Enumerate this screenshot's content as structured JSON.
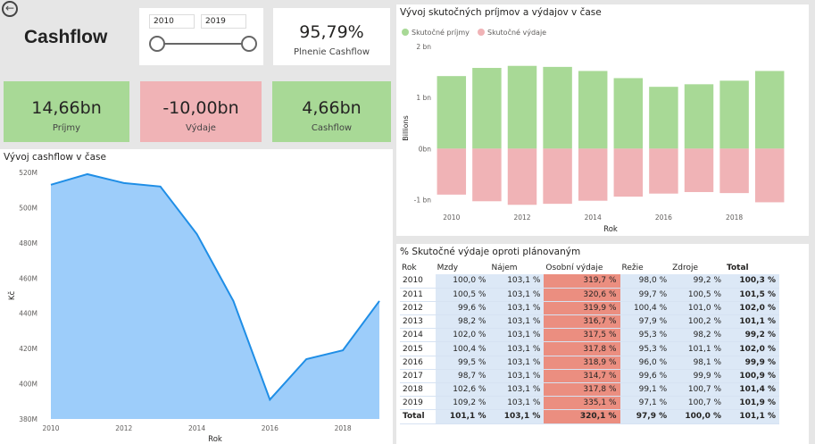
{
  "header": {
    "title": "Cashflow"
  },
  "slicer": {
    "from": "2010",
    "to": "2019"
  },
  "plnenie": {
    "value": "95,79%",
    "label": "Plnenie Cashflow"
  },
  "kpis": [
    {
      "value": "14,66bn",
      "label": "Príjmy"
    },
    {
      "value": "-10,00bn",
      "label": "Výdaje"
    },
    {
      "value": "4,66bn",
      "label": "Cashflow"
    }
  ],
  "colors": {
    "income": "#a8d996",
    "expense": "#f0b3b6",
    "area": "#9dcdfa",
    "line": "#1f8ee6",
    "hot": "#eb8e80",
    "cell": "#dce8f6"
  },
  "chart_data": [
    {
      "type": "area",
      "title": "Vývoj cashflow v čase",
      "xlabel": "Rok",
      "ylabel": "Kč",
      "x": [
        2010,
        2011,
        2012,
        2013,
        2014,
        2015,
        2016,
        2017,
        2018,
        2019
      ],
      "values": [
        513,
        519,
        514,
        512,
        485,
        447,
        391,
        414,
        419,
        447
      ],
      "yunit": "M",
      "ylim": [
        380,
        520
      ],
      "yticks": [
        "380M",
        "400M",
        "420M",
        "440M",
        "460M",
        "480M",
        "500M",
        "520M"
      ],
      "ytick_values": [
        380,
        400,
        420,
        440,
        460,
        480,
        500,
        520
      ],
      "xticks": [
        "2010",
        "2012",
        "2014",
        "2016",
        "2018"
      ]
    },
    {
      "type": "bar",
      "title": "Vývoj skutočných príjmov a výdajov v čase",
      "xlabel": "Rok",
      "ylabel": "Billions",
      "legend": "top-left",
      "categories": [
        2010,
        2011,
        2012,
        2013,
        2014,
        2015,
        2016,
        2017,
        2018,
        2019
      ],
      "series": [
        {
          "name": "Skutočné príjmy",
          "values": [
            1.42,
            1.58,
            1.62,
            1.6,
            1.52,
            1.38,
            1.21,
            1.26,
            1.33,
            1.52
          ]
        },
        {
          "name": "Skutočné výdaje",
          "values": [
            -0.9,
            -1.03,
            -1.1,
            -1.08,
            -1.02,
            -0.94,
            -0.88,
            -0.85,
            -0.87,
            -1.05
          ]
        }
      ],
      "ylim": [
        -1.2,
        2.0
      ],
      "yticks": [
        "-1 bn",
        "0bn",
        "1 bn",
        "2 bn"
      ],
      "ytick_values": [
        -1,
        0,
        1,
        2
      ],
      "xticks": [
        "2010",
        "2012",
        "2014",
        "2016",
        "2018"
      ]
    },
    {
      "type": "table",
      "title": "% Skutočné výdaje oproti plánovaným",
      "columns": [
        "Rok",
        "Mzdy",
        "Nájem",
        "Osobní výdaje",
        "Režie",
        "Zdroje",
        "Total"
      ],
      "rows": [
        [
          "2010",
          "100,0 %",
          "103,1 %",
          "319,7 %",
          "98,0 %",
          "99,2 %",
          "100,3 %"
        ],
        [
          "2011",
          "100,5 %",
          "103,1 %",
          "320,6 %",
          "99,7 %",
          "100,5 %",
          "101,5 %"
        ],
        [
          "2012",
          "99,6 %",
          "103,1 %",
          "319,9 %",
          "100,4 %",
          "101,0 %",
          "102,0 %"
        ],
        [
          "2013",
          "98,2 %",
          "103,1 %",
          "316,7 %",
          "97,9 %",
          "100,2 %",
          "101,1 %"
        ],
        [
          "2014",
          "102,0 %",
          "103,1 %",
          "317,5 %",
          "95,3 %",
          "98,2 %",
          "99,2 %"
        ],
        [
          "2015",
          "100,4 %",
          "103,1 %",
          "317,8 %",
          "95,3 %",
          "101,1 %",
          "102,0 %"
        ],
        [
          "2016",
          "99,5 %",
          "103,1 %",
          "318,9 %",
          "96,0 %",
          "98,1 %",
          "99,9 %"
        ],
        [
          "2017",
          "98,7 %",
          "103,1 %",
          "314,7 %",
          "99,6 %",
          "99,9 %",
          "100,9 %"
        ],
        [
          "2018",
          "102,6 %",
          "103,1 %",
          "317,8 %",
          "99,1 %",
          "100,7 %",
          "101,4 %"
        ],
        [
          "2019",
          "109,2 %",
          "103,1 %",
          "335,1 %",
          "97,1 %",
          "100,7 %",
          "101,9 %"
        ]
      ],
      "total": [
        "Total",
        "101,1 %",
        "103,1 %",
        "320,1 %",
        "97,9 %",
        "100,0 %",
        "101,1 %"
      ]
    }
  ]
}
